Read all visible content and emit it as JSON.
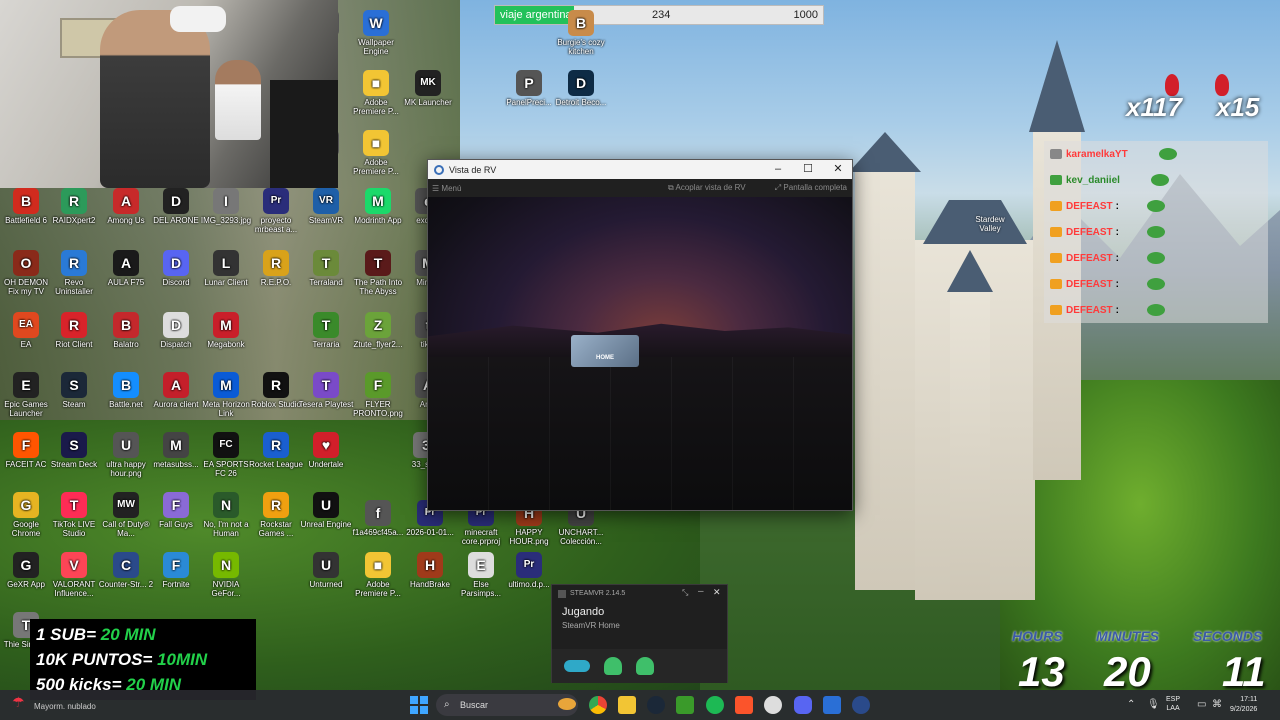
{
  "goal_bar": {
    "label": "viaje argentina",
    "current": "234",
    "target": "1000",
    "progress": 0.234
  },
  "vr_window": {
    "title": "Vista de RV",
    "menu_label": "Menú",
    "dock_label": "Acoplar vista de RV",
    "fullscreen_label": "Pantalla completa",
    "minimize_icon": "minimize-icon",
    "maximize_icon": "maximize-icon",
    "close_icon": "close-icon",
    "home_card_label": "HOME"
  },
  "desktop_icons": [
    {
      "label": "Wallpaper Engine",
      "color": "#2a6fd6",
      "glyph": "W"
    },
    {
      "label": "Burgie's cozy kitchen",
      "color": "#c88b4a",
      "glyph": "B"
    },
    {
      "label": "Adobe Premiere P...",
      "color": "#f2c534",
      "glyph": "■"
    },
    {
      "label": "MK Launcher",
      "color": "#222",
      "glyph": "MK"
    },
    {
      "label": "PanelPreci...",
      "color": "#555",
      "glyph": "P"
    },
    {
      "label": "Detroit Beco...",
      "color": "#0e2b45",
      "glyph": "D"
    },
    {
      "label": "Adobe Premiere P...",
      "color": "#f2c534",
      "glyph": "■"
    },
    {
      "label": "Battlefield 6",
      "color": "#d12b1e",
      "glyph": "B"
    },
    {
      "label": "RAIDXpert2",
      "color": "#2c9a5a",
      "glyph": "R"
    },
    {
      "label": "Among Us",
      "color": "#c72a2a",
      "glyph": "A"
    },
    {
      "label": "DEL ARONE",
      "color": "#222",
      "glyph": "D"
    },
    {
      "label": "IMG_3293.jpg",
      "color": "#777",
      "glyph": "I"
    },
    {
      "label": "proyecto mrbeast a...",
      "color": "#2a2d7a",
      "glyph": "Pr"
    },
    {
      "label": "SteamVR",
      "color": "#1e5fa8",
      "glyph": "VR"
    },
    {
      "label": "Modrinth App",
      "color": "#1bd96a",
      "glyph": "M"
    },
    {
      "label": "OH DEMON Fix my TV",
      "color": "#8a2a1a",
      "glyph": "O"
    },
    {
      "label": "Revo Uninstaller",
      "color": "#2a7ad6",
      "glyph": "R"
    },
    {
      "label": "AULA F75",
      "color": "#1a1a1a",
      "glyph": "A"
    },
    {
      "label": "Discord",
      "color": "#5865f2",
      "glyph": "D"
    },
    {
      "label": "Lunar Client",
      "color": "#333",
      "glyph": "L"
    },
    {
      "label": "R.E.P.O.",
      "color": "#d9a21a",
      "glyph": "R"
    },
    {
      "label": "Terraland",
      "color": "#6b8a3a",
      "glyph": "T"
    },
    {
      "label": "The Path Into The Abyss",
      "color": "#5a1a1a",
      "glyph": "T"
    },
    {
      "label": "EA",
      "color": "#e0481f",
      "glyph": "EA"
    },
    {
      "label": "Riot Client",
      "color": "#d8232a",
      "glyph": "R"
    },
    {
      "label": "Balatro",
      "color": "#c4282c",
      "glyph": "B"
    },
    {
      "label": "Dispatch",
      "color": "#ddd",
      "glyph": "D"
    },
    {
      "label": "Megabonk",
      "color": "#c91f2a",
      "glyph": "M"
    },
    {
      "label": "Terraria",
      "color": "#3a8a2a",
      "glyph": "T"
    },
    {
      "label": "Ztute_flyer2...",
      "color": "#6ba33a",
      "glyph": "Z"
    },
    {
      "label": "Epic Games Launcher",
      "color": "#222",
      "glyph": "E"
    },
    {
      "label": "Steam",
      "color": "#1b2838",
      "glyph": "S"
    },
    {
      "label": "Battle.net",
      "color": "#148eff",
      "glyph": "B"
    },
    {
      "label": "Aurora client",
      "color": "#c41f2a",
      "glyph": "A"
    },
    {
      "label": "Meta Horizon Link",
      "color": "#0a5bd6",
      "glyph": "M"
    },
    {
      "label": "Roblox Studio",
      "color": "#111",
      "glyph": "R"
    },
    {
      "label": "Tesera Playtest",
      "color": "#7a4ac8",
      "glyph": "T"
    },
    {
      "label": "FLYER PRONTO.png",
      "color": "#5a9a2a",
      "glyph": "F"
    },
    {
      "label": "FACEIT AC",
      "color": "#ff5500",
      "glyph": "F"
    },
    {
      "label": "Stream Deck",
      "color": "#1a1a4a",
      "glyph": "S"
    },
    {
      "label": "ultra happy hour.png",
      "color": "#555",
      "glyph": "U"
    },
    {
      "label": "metasubss...",
      "color": "#444",
      "glyph": "M"
    },
    {
      "label": "EA SPORTS FC 26",
      "color": "#111",
      "glyph": "FC"
    },
    {
      "label": "Rocket League",
      "color": "#1a5fd0",
      "glyph": "R"
    },
    {
      "label": "Undertale",
      "color": "#d21f2a",
      "glyph": "♥"
    },
    {
      "label": "33_sn...",
      "color": "#777",
      "glyph": "3"
    },
    {
      "label": "Google Chrome",
      "color": "#e6b422",
      "glyph": "G"
    },
    {
      "label": "TikTok LIVE Studio",
      "color": "#fe2c55",
      "glyph": "T"
    },
    {
      "label": "Call of Duty® Ma...",
      "color": "#222",
      "glyph": "MW"
    },
    {
      "label": "Fall Guys",
      "color": "#8a6ad6",
      "glyph": "F"
    },
    {
      "label": "No, I'm not a Human",
      "color": "#2a5a2a",
      "glyph": "N"
    },
    {
      "label": "Rockstar Games ...",
      "color": "#f0a010",
      "glyph": "R"
    },
    {
      "label": "Unreal Engine",
      "color": "#111",
      "glyph": "U"
    },
    {
      "label": "f1a469cf45a...",
      "color": "#555",
      "glyph": "f"
    },
    {
      "label": "2026-01-01...",
      "color": "#2a2d7a",
      "glyph": "Pr"
    },
    {
      "label": "minecraft core.prproj",
      "color": "#2a2d7a",
      "glyph": "Pr"
    },
    {
      "label": "HAPPY HOUR.png",
      "color": "#a03a1a",
      "glyph": "H"
    },
    {
      "label": "UNCHART... Colección...",
      "color": "#444",
      "glyph": "U"
    },
    {
      "label": "GeXR App",
      "color": "#222",
      "glyph": "G"
    },
    {
      "label": "VALORANT Influence...",
      "color": "#fd4556",
      "glyph": "V"
    },
    {
      "label": "Counter-Str... 2",
      "color": "#2a4a8a",
      "glyph": "C"
    },
    {
      "label": "Fortnite",
      "color": "#2a8ad6",
      "glyph": "F"
    },
    {
      "label": "NVIDIA GeFor...",
      "color": "#76b900",
      "glyph": "N"
    },
    {
      "label": "Unturned",
      "color": "#333",
      "glyph": "U"
    },
    {
      "label": "Adobe Premiere P...",
      "color": "#f2c534",
      "glyph": "■"
    },
    {
      "label": "HandBrake",
      "color": "#a03a1a",
      "glyph": "H"
    },
    {
      "label": "Else Parsimps...",
      "color": "#ddd",
      "glyph": "E"
    },
    {
      "label": "ultimo.d.p...",
      "color": "#2a2d7a",
      "glyph": "Pr"
    },
    {
      "label": "Thie Simul...",
      "color": "#777",
      "glyph": "T"
    },
    {
      "label": "Minir...",
      "color": "#555",
      "glyph": "M"
    },
    {
      "label": "exch...",
      "color": "#555",
      "glyph": "e"
    },
    {
      "label": "Yet",
      "color": "#555",
      "glyph": "Y"
    },
    {
      "label": "tik...",
      "color": "#555",
      "glyph": "t"
    },
    {
      "label": "An...",
      "color": "#555",
      "glyph": "A"
    },
    {
      "label": "P",
      "color": "#555",
      "glyph": "P"
    }
  ],
  "chat_overlay": {
    "rows": [
      {
        "user": "karamelkaYT",
        "tag": "",
        "style": "user"
      },
      {
        "user": "kev_daniiel",
        "tag": "",
        "style": "green"
      },
      {
        "user": "DEFEAST",
        "tag": ":",
        "style": "red"
      },
      {
        "user": "DEFEAST",
        "tag": ":",
        "style": "red"
      },
      {
        "user": "DEFEAST",
        "tag": ":",
        "style": "red"
      },
      {
        "user": "DEFEAST",
        "tag": ":",
        "style": "red"
      },
      {
        "user": "DEFEAST",
        "tag": ":",
        "style": "red"
      }
    ],
    "multiplier_a": "x117",
    "multiplier_b": "x15",
    "overlay_label": "Stardew Valley"
  },
  "steamvr": {
    "title": "STEAMVR 2.14.5",
    "status": "Jugando",
    "app": "SteamVR Home"
  },
  "sub_box": {
    "line1_a": "1 SUB= ",
    "line1_b": "20 MIN",
    "line2_a": "10K PUNTOS= ",
    "line2_b": "10MIN",
    "line3_a": "500 kicks= ",
    "line3_b": "20 MIN"
  },
  "countdown": {
    "hours_label": "HOURS",
    "hours": "13",
    "minutes_label": "MINUTES",
    "minutes": "20",
    "seconds_label": "SECONDS",
    "seconds": "11"
  },
  "taskbar": {
    "weather": "Mayorm. nublado",
    "search_placeholder": "Buscar",
    "lang_line1": "ESP",
    "lang_line2": "LAA",
    "time": "17:11",
    "date": "9/2/2026"
  }
}
